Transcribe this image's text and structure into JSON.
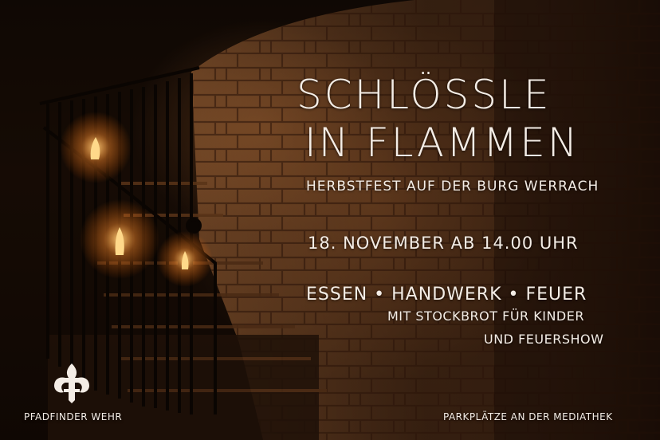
{
  "title_line1": "Schlössle",
  "title_line2": "in Flammen",
  "subtitle": "Herbstfest auf der Burg Werrach",
  "date": "18. November ab 14.00 Uhr",
  "activities": "Essen • Handwerk • Feuer",
  "extra_line1": "mit Stockbrot für Kinder",
  "extra_line2": "und Feuershow",
  "organizer": "Pfadfinder Wehr",
  "parking": "Parkplätze an der Mediathek",
  "colors": {
    "text": "#f4ede6",
    "stone": "#8a5a34",
    "flame": "#ffb347"
  },
  "icons": [
    "scout-lily-logo",
    "torch-flame-icon"
  ]
}
